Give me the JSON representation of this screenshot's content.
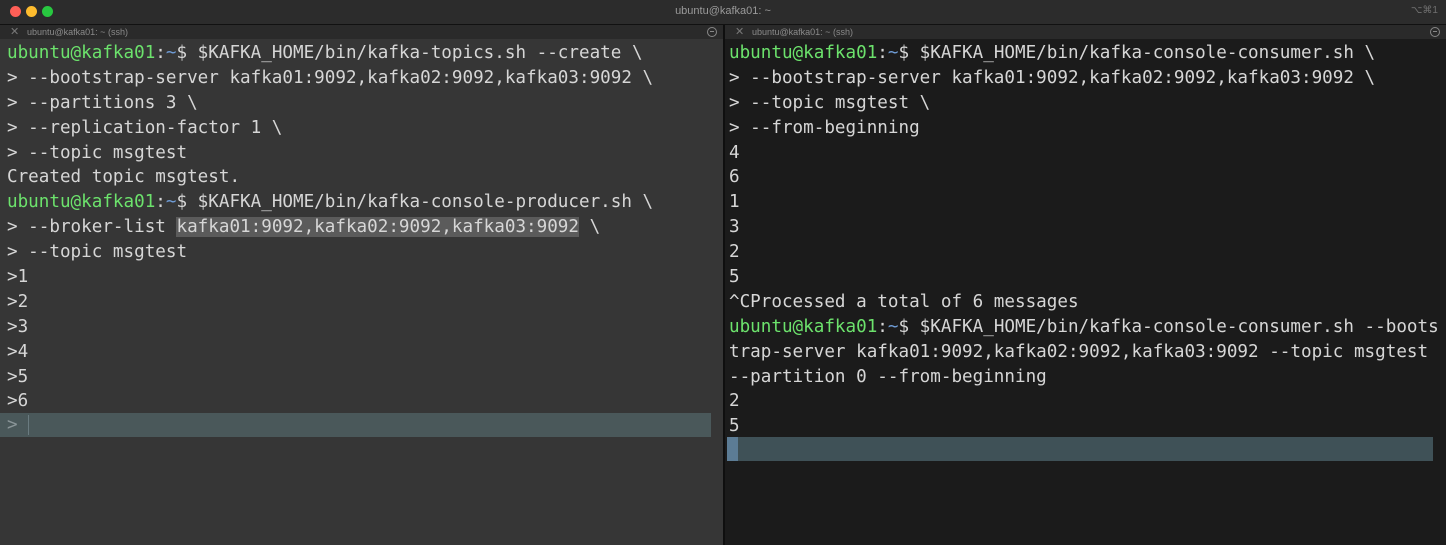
{
  "window": {
    "title": "ubuntu@kafka01: ~",
    "shortcut": "⌥⌘1"
  },
  "tabs": {
    "left": {
      "label": "ubuntu@kafka01: ~ (ssh)",
      "close": "✕"
    },
    "right": {
      "label": "ubuntu@kafka01: ~ (ssh)",
      "close": "✕"
    }
  },
  "prompt": {
    "user_host": "ubuntu@kafka01",
    "colon": ":",
    "path": "~",
    "symbol": "$"
  },
  "left_pane": {
    "lines": [
      {
        "cmd": " $KAFKA_HOME/bin/kafka-topics.sh --create \\"
      },
      {
        "text": "> --bootstrap-server kafka01:9092,kafka02:9092,kafka03:9092 \\"
      },
      {
        "text": "> --partitions 3 \\"
      },
      {
        "text": "> --replication-factor 1 \\"
      },
      {
        "text": "> --topic msgtest"
      },
      {
        "text": "Created topic msgtest."
      },
      {
        "cmd": " $KAFKA_HOME/bin/kafka-console-producer.sh \\"
      },
      {
        "pre": "> --broker-list ",
        "selected": "kafka01:9092,kafka02:9092,kafka03:9092",
        "post": " \\"
      },
      {
        "text": "> --topic msgtest"
      },
      {
        "text": ">1"
      },
      {
        "text": ">2"
      },
      {
        "text": ">3"
      },
      {
        "text": ">4"
      },
      {
        "text": ">5"
      },
      {
        "text": ">6"
      }
    ],
    "current_input": ">"
  },
  "right_pane": {
    "lines": [
      {
        "cmd": " $KAFKA_HOME/bin/kafka-console-consumer.sh \\"
      },
      {
        "text": "> --bootstrap-server kafka01:9092,kafka02:9092,kafka03:9092 \\"
      },
      {
        "text": "> --topic msgtest \\"
      },
      {
        "text": "> --from-beginning"
      },
      {
        "text": "4"
      },
      {
        "text": "6"
      },
      {
        "text": "1"
      },
      {
        "text": "3"
      },
      {
        "text": "2"
      },
      {
        "text": "5"
      },
      {
        "text": "^CProcessed a total of 6 messages"
      },
      {
        "cmd": " $KAFKA_HOME/bin/kafka-console-consumer.sh --boots"
      },
      {
        "text": "trap-server kafka01:9092,kafka02:9092,kafka03:9092 --topic msgtest"
      },
      {
        "text": "--partition 0 --from-beginning"
      },
      {
        "text": "2"
      },
      {
        "text": "5"
      }
    ]
  }
}
